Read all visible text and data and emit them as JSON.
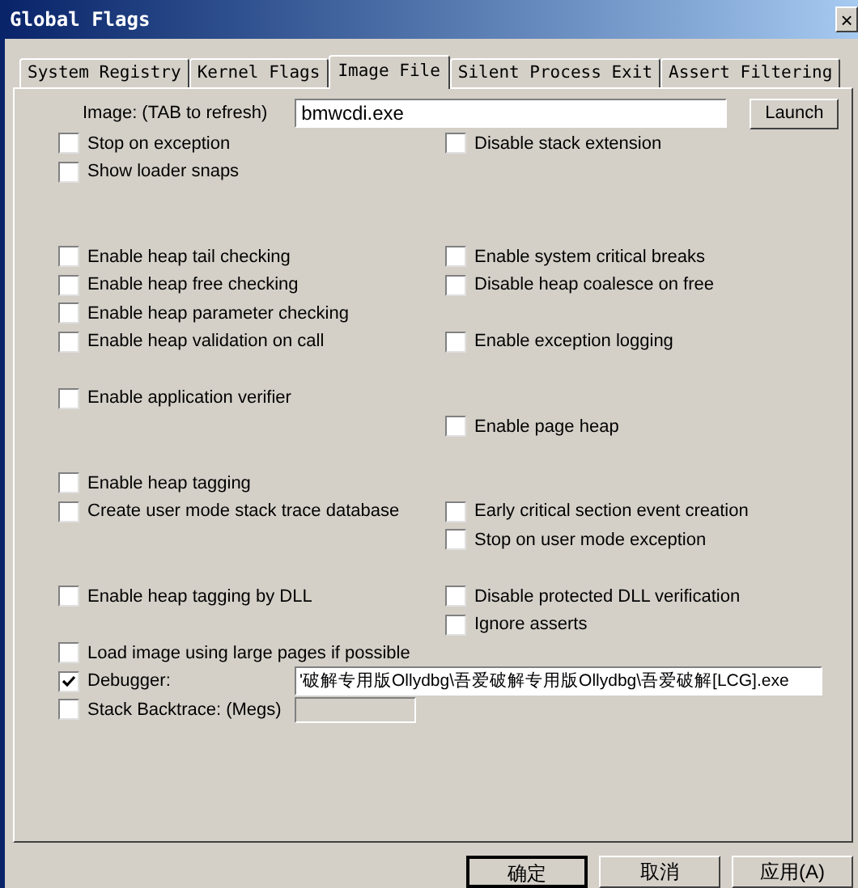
{
  "window": {
    "title": "Global Flags",
    "close": "×"
  },
  "tabs": [
    {
      "label": "System Registry",
      "selected": false
    },
    {
      "label": "Kernel Flags",
      "selected": false
    },
    {
      "label": "Image File",
      "selected": true
    },
    {
      "label": "Silent Process Exit",
      "selected": false
    },
    {
      "label": "Assert Filtering",
      "selected": false
    }
  ],
  "image": {
    "label": "Image: (TAB to refresh)",
    "value": "bmwcdi.exe",
    "button": "Launch"
  },
  "rows": [
    {
      "kind": "options",
      "left": {
        "label": "Stop on exception",
        "checked": false
      },
      "right": {
        "label": "Disable stack extension",
        "checked": false
      }
    },
    {
      "kind": "options",
      "left": {
        "label": "Show loader snaps",
        "checked": false
      }
    },
    {
      "kind": "gap"
    },
    {
      "kind": "gap"
    },
    {
      "kind": "options",
      "left": {
        "label": "Enable heap tail checking",
        "checked": false
      },
      "right": {
        "label": "Enable system critical breaks",
        "checked": false
      }
    },
    {
      "kind": "options",
      "left": {
        "label": "Enable heap free checking",
        "checked": false
      },
      "right": {
        "label": "Disable heap coalesce on free",
        "checked": false
      }
    },
    {
      "kind": "options",
      "left": {
        "label": "Enable heap parameter checking",
        "checked": false
      }
    },
    {
      "kind": "options",
      "left": {
        "label": "Enable heap validation on call",
        "checked": false
      },
      "right": {
        "label": "Enable exception logging",
        "checked": false
      }
    },
    {
      "kind": "gap"
    },
    {
      "kind": "options",
      "left": {
        "label": "Enable application verifier",
        "checked": false
      }
    },
    {
      "kind": "options",
      "right": {
        "label": "Enable page heap",
        "checked": false
      }
    },
    {
      "kind": "gap"
    },
    {
      "kind": "options",
      "left": {
        "label": "Enable heap tagging",
        "checked": false
      }
    },
    {
      "kind": "options",
      "left": {
        "label": "Create user mode stack trace database",
        "checked": false
      },
      "right": {
        "label": "Early critical section event creation",
        "checked": false
      }
    },
    {
      "kind": "options",
      "right": {
        "label": "Stop on user mode exception",
        "checked": false
      }
    },
    {
      "kind": "gap"
    },
    {
      "kind": "options",
      "left": {
        "label": "Enable heap tagging by DLL",
        "checked": false
      },
      "right": {
        "label": "Disable protected DLL verification",
        "checked": false
      }
    },
    {
      "kind": "options",
      "right": {
        "label": "Ignore asserts",
        "checked": false
      }
    },
    {
      "kind": "options",
      "left": {
        "label": "Load image using large pages if possible",
        "checked": false
      }
    },
    {
      "kind": "field",
      "left": {
        "label": "Debugger:",
        "checked": true
      },
      "value": "'破解专用版Ollydbg\\吾爱破解专用版Ollydbg\\吾爱破解[LCG].exe",
      "disabled": false
    },
    {
      "kind": "field",
      "left": {
        "label": "Stack Backtrace: (Megs)",
        "checked": false
      },
      "disabled": true
    }
  ],
  "buttons": [
    {
      "label": "确定",
      "default": true
    },
    {
      "label": "取消",
      "default": false
    },
    {
      "label": "应用(A)",
      "default": false
    }
  ]
}
